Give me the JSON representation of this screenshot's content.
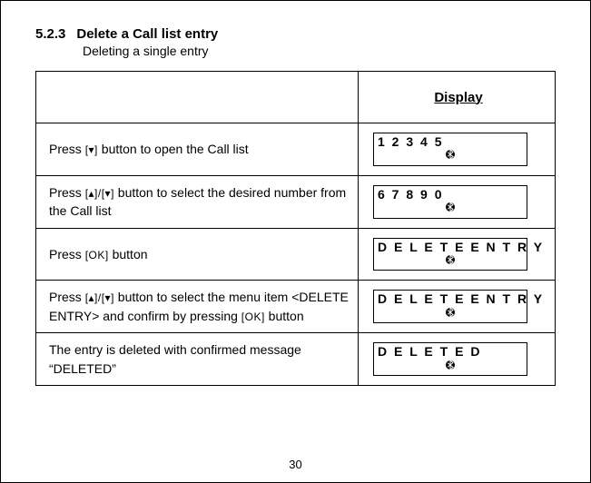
{
  "section": {
    "number": "5.2.3",
    "title": "Delete a Call list entry",
    "subtitle": "Deleting a single entry"
  },
  "keys": {
    "down": "[▾]",
    "updown": "[▴]/[▾]",
    "ok": "[OK]"
  },
  "table": {
    "display_header": "Display",
    "rows": [
      {
        "instr_parts": [
          "Press ",
          "@keys.down",
          " button to open the Call list"
        ],
        "lcd1": "1 2 3 4 5"
      },
      {
        "instr_parts": [
          "Press ",
          "@keys.updown",
          " button to select the desired number from the Call list"
        ],
        "lcd1": "6 7 8 9 0"
      },
      {
        "instr_parts": [
          "Press ",
          "@keys.ok",
          " button"
        ],
        "lcd1": "D E L E T E    E N T R Y"
      },
      {
        "instr_parts": [
          "Press ",
          "@keys.updown",
          " button to select the menu item <DELETE ENTRY> and confirm by pressing ",
          "@keys.ok",
          " button"
        ],
        "lcd1": "D E L E T E    E N T R Y"
      },
      {
        "instr_parts": [
          "The entry is deleted  with confirmed message “DELETED”"
        ],
        "lcd1": "D E L E T E D"
      }
    ]
  },
  "page_number": "30"
}
